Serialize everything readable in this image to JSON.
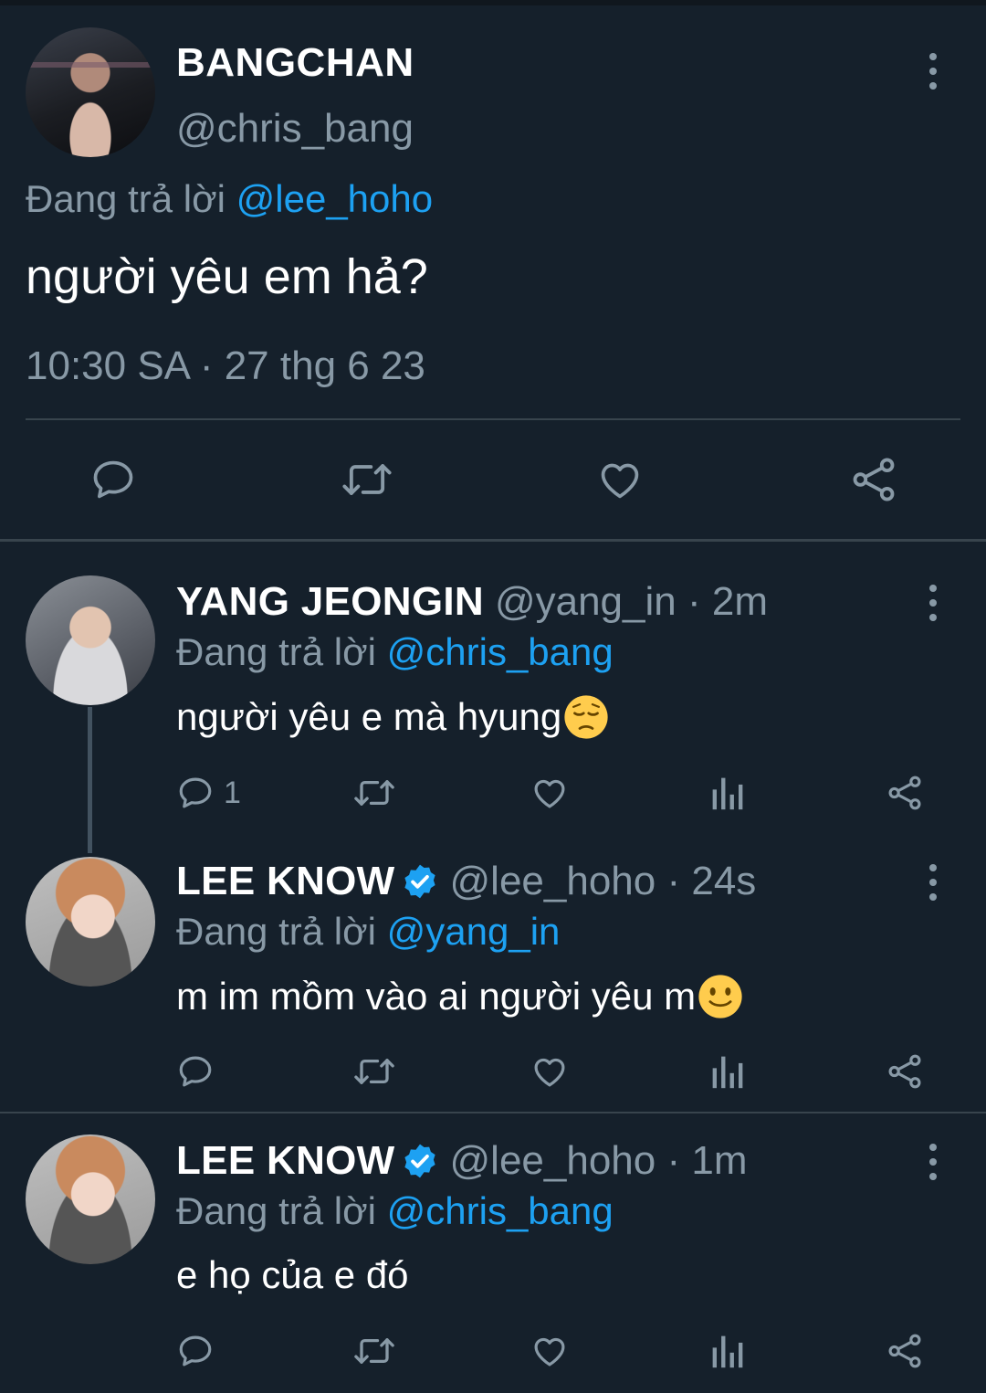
{
  "main_tweet": {
    "name": "BANGCHAN",
    "handle": "@chris_bang",
    "replying_to_label": "Đang trả lời ",
    "replying_to_handle": "@lee_hoho",
    "text": "người yêu em hả?",
    "timestamp": "10:30 SA · 27 thg 6 23",
    "actions": [
      "reply-icon",
      "retweet-icon",
      "like-icon",
      "share-icon"
    ]
  },
  "replies": [
    {
      "name": "YANG JEONGIN",
      "meta": "@yang_in · 2m",
      "verified": false,
      "replying_to_label": "Đang trả lời ",
      "replying_to_handle": "@chris_bang",
      "text": "người yêu e mà hyung",
      "emoji": "pensive-face",
      "reply_count": "1"
    },
    {
      "name": "LEE KNOW",
      "meta": "@lee_hoho · 24s",
      "verified": true,
      "replying_to_label": "Đang trả lời ",
      "replying_to_handle": "@yang_in",
      "text": "m im mồm vào ai người yêu m",
      "emoji": "slightly-smiling-face",
      "reply_count": ""
    },
    {
      "name": "LEE KNOW",
      "meta": "@lee_hoho · 1m",
      "verified": true,
      "replying_to_label": "Đang trả lời ",
      "replying_to_handle": "@chris_bang",
      "text": "e họ của e đó",
      "emoji": "",
      "reply_count": ""
    }
  ],
  "colors": {
    "background": "#15202b",
    "text": "#ffffff",
    "secondary": "#8899a6",
    "accent": "#1da1f2",
    "divider": "#38444d"
  }
}
